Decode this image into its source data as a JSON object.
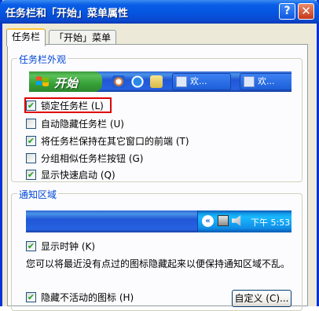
{
  "window": {
    "title": "任务栏和「开始」菜单属性",
    "help_label": "?",
    "close_label": "✕"
  },
  "tabs": [
    {
      "label": "任务栏",
      "active": true
    },
    {
      "label": "「开始」菜单",
      "active": false
    }
  ],
  "appearance_group": {
    "label": "任务栏外观",
    "preview": {
      "start_label": "开始",
      "task_buttons": [
        {
          "label": "欢..."
        },
        {
          "label": "欢..."
        }
      ],
      "quick_launch_icons": [
        "media-player-icon",
        "internet-explorer-icon",
        "folder-icon"
      ]
    },
    "options": [
      {
        "label": "锁定任务栏 (L)",
        "checked": true
      },
      {
        "label": "自动隐藏任务栏 (U)",
        "checked": false
      },
      {
        "label": "将任务栏保持在其它窗口的前端 (T)",
        "checked": true
      },
      {
        "label": "分组相似任务栏按钮 (G)",
        "checked": false
      },
      {
        "label": "显示快速启动 (Q)",
        "checked": true
      }
    ]
  },
  "notification_group": {
    "label": "通知区域",
    "clock_text": "下午 5:53",
    "chevron": "«",
    "options": [
      {
        "label": "显示时钟 (K)",
        "checked": true
      },
      {
        "label": "隐藏不活动的图标 (H)",
        "checked": true
      }
    ],
    "info_text": "您可以将最近没有点过的图标隐藏起来以便保持通知区域不乱。",
    "customize_button": "自定义 (C)..."
  },
  "colors": {
    "highlight_box": "#e00000",
    "titlebar": "#0a5ee6",
    "taskbar": "#2157d7",
    "start_button": "#37a037"
  }
}
